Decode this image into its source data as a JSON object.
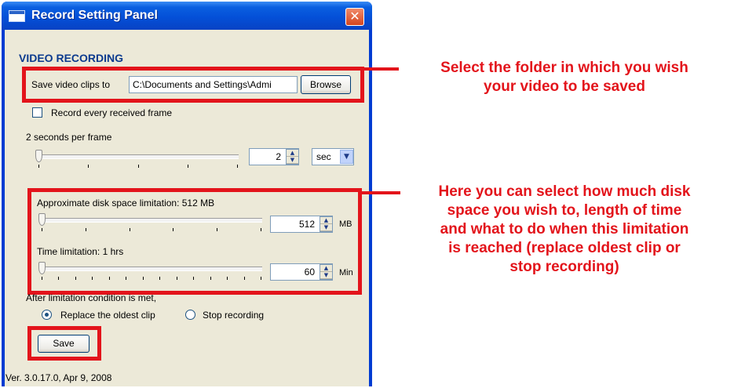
{
  "window": {
    "title": "Record Setting Panel"
  },
  "section_title": "VIDEO RECORDING",
  "save_path": {
    "label": "Save video clips to",
    "value": "C:\\Documents and Settings\\Admi",
    "browse_label": "Browse"
  },
  "record_every_frame": {
    "label": "Record every received frame",
    "checked": false
  },
  "frame_rate": {
    "label": "2 seconds per frame",
    "value": "2",
    "unit": "sec",
    "slider_fraction": 0.0
  },
  "disk_limit": {
    "label": "Approximate disk space limitation:  512 MB",
    "value": "512",
    "unit": "MB",
    "slider_fraction": 0.0
  },
  "time_limit": {
    "label": "Time limitation:  1 hrs",
    "value": "60",
    "unit": "Min",
    "slider_fraction": 0.0
  },
  "after_limit": {
    "label": "After limitation condition is met,",
    "options": [
      {
        "label": "Replace the oldest clip",
        "selected": true
      },
      {
        "label": "Stop recording",
        "selected": false
      }
    ]
  },
  "save_button": "Save",
  "version": "Ver. 3.0.17.0, Apr 9, 2008",
  "annotations": {
    "folder": [
      "Select the folder in which you wish",
      "your video to be saved"
    ],
    "limits": [
      "Here you can select how much disk",
      "space you wish to, length of time",
      "and what to do when this limitation",
      "is reached (replace oldest clip or",
      "stop recording)"
    ]
  },
  "colors": {
    "annotation_red": "#e3141b",
    "title_blue": "#0450d8",
    "panel_bg": "#ece9d8"
  }
}
